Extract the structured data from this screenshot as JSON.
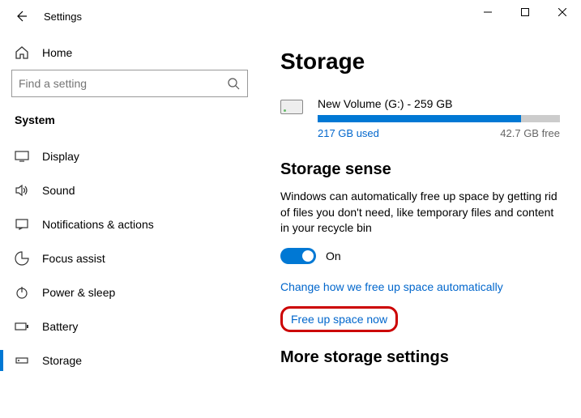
{
  "titlebar": {
    "title": "Settings"
  },
  "sidebar": {
    "home": "Home",
    "search_placeholder": "Find a setting",
    "section": "System",
    "items": [
      {
        "label": "Display"
      },
      {
        "label": "Sound"
      },
      {
        "label": "Notifications & actions"
      },
      {
        "label": "Focus assist"
      },
      {
        "label": "Power & sleep"
      },
      {
        "label": "Battery"
      },
      {
        "label": "Storage"
      }
    ]
  },
  "page": {
    "title": "Storage",
    "drive": {
      "name": "New Volume (G:) - 259 GB",
      "used": "217 GB used",
      "free": "42.7 GB free"
    },
    "sense": {
      "heading": "Storage sense",
      "desc": "Windows can automatically free up space by getting rid of files you don't need, like temporary files and content in your recycle bin",
      "toggle_label": "On",
      "link_change": "Change how we free up space automatically",
      "link_free": "Free up space now"
    },
    "more_heading": "More storage settings"
  }
}
